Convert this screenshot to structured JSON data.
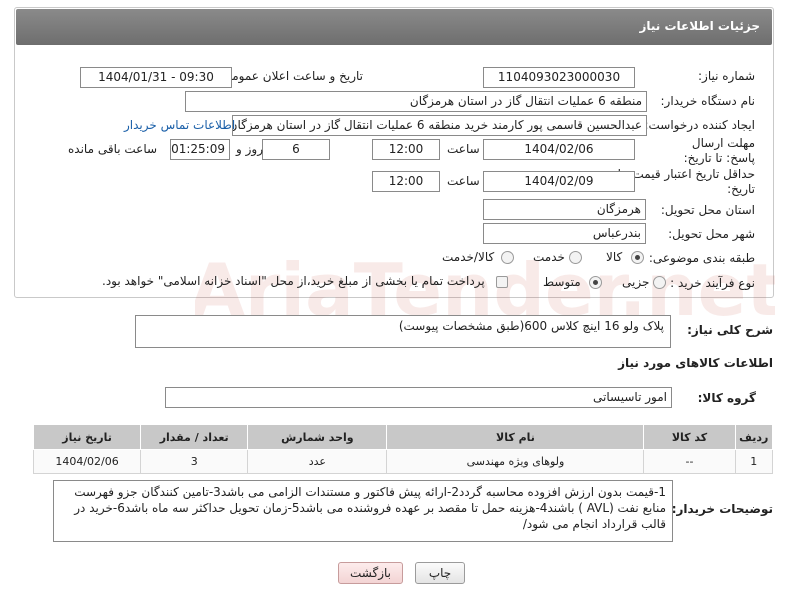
{
  "panel": {
    "title": "جزئیات اطلاعات نیاز"
  },
  "fields": {
    "need_number_label": "شماره نیاز:",
    "need_number": "1104093023000030",
    "announce_label": "تاریخ و ساعت اعلان عمومی:",
    "announce_value": "1404/01/31 - 09:30",
    "buyer_label": "نام دستگاه خریدار:",
    "buyer_value": "منطقه 6 عملیات انتقال گاز در استان هرمزگان",
    "creator_label": "ایجاد کننده درخواست:",
    "creator_value": "عبدالحسین قاسمی پور کارمند خرید منطقه 6 عملیات انتقال گاز در استان هرمزگان",
    "contact_link": "اطلاعات تماس خریدار",
    "reply_deadline_label": "مهلت ارسال پاسخ: تا تاریخ:",
    "reply_date": "1404/02/06",
    "time_label": "ساعت",
    "reply_time": "12:00",
    "days_value": "6",
    "days_label": "روز و",
    "remaining_value": "01:25:09",
    "remaining_label": "ساعت باقی مانده",
    "price_validity_label": "حداقل تاریخ اعتبار قیمت: تا تاریخ:",
    "price_date": "1404/02/09",
    "price_time": "12:00",
    "province_label": "استان محل تحویل:",
    "province_value": "هرمزگان",
    "city_label": "شهر محل تحویل:",
    "city_value": "بندرعباس",
    "category_label": "طبقه بندی موضوعی:",
    "category_options": [
      "کالا",
      "خدمت",
      "کالا/خدمت"
    ],
    "process_label": "نوع فرآیند خرید :",
    "process_options": [
      "جزیی",
      "متوسط"
    ],
    "payment_note": "پرداخت تمام یا بخشی از مبلغ خرید،از محل \"اسناد خزانه اسلامی\" خواهد بود."
  },
  "summary": {
    "label": "شرح کلی نیاز:",
    "value": "پلاک ولو 16 اینچ کلاس 600(طبق مشخصات پیوست)"
  },
  "goods": {
    "section_title": "اطلاعات کالاهای مورد نیاز",
    "group_label": "گروه کالا:",
    "group_value": "امور تاسیساتی",
    "columns": [
      "ردیف",
      "کد کالا",
      "نام کالا",
      "واحد شمارش",
      "تعداد / مقدار",
      "تاریخ نیاز"
    ],
    "rows": [
      {
        "row": "1",
        "code": "--",
        "name": "ولوهای ویژه مهندسی",
        "unit": "عدد",
        "qty": "3",
        "date": "1404/02/06"
      }
    ]
  },
  "buyer_notes": {
    "label": "توضیحات خریدار:",
    "value": "1-قیمت بدون ارزش افزوده محاسبه گردد2-ارائه پیش فاکتور و مستندات الزامی می باشد3-تامین کنندگان جزو فهرست منابع نفت (AVL ) باشند4-هزینه حمل تا مقصد بر عهده فروشنده می باشد5-زمان تحویل حداکثر سه ماه باشد6-خرید در قالب قرارداد انجام می شود/"
  },
  "buttons": {
    "print": "چاپ",
    "back": "بازگشت"
  },
  "colors": {
    "header": "#7a7a7a",
    "link": "#1a5fa8",
    "table_head": "#c8c8c8"
  }
}
